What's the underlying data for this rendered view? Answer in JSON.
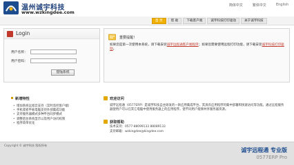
{
  "header": {
    "brand_title": "温州诚宇科技",
    "brand_url": "www.wzkingdee.com",
    "lang_links": [
      "简体中文",
      "繁体中文",
      "English"
    ]
  },
  "nav": {
    "tabs": [
      "首 页",
      "帮 助",
      "下载客户端",
      "诚宇科技打印驱动",
      "关于诚宇科技"
    ],
    "active_index": 0
  },
  "login": {
    "title": "Login",
    "username_label": "用户名称：",
    "username_value": "",
    "password_label": "用户密码：",
    "password_value": "",
    "submit_label": "登陆系统"
  },
  "notice": {
    "title": "重要提醒！",
    "line1_prefix": "如果您是第一次使用本系统，请下载安装",
    "line1_link": "诚宇远程通客户端程序",
    "line1_mid": "；如果您需要使用远程打印功能，请下载安装",
    "line1_link2": "诚宇科技打印驱动",
    "line1_suffix": "。"
  },
  "features": {
    "title": "新增特性",
    "items": [
      "增加系统远程云支持（实时监控客户端）",
      "手机或者平板电脑支持外部集成功能",
      "支持服务器模式多种平台同步模式",
      "调整后台系统显示以及用户访问权限",
      "程序简单优化"
    ]
  },
  "welcome": {
    "title": "欢迎访问",
    "body": "诚宇远程通（0577ERP）是诚宇科技自主研发的一款应用集成平台，其具有应用程序的集中部署和快速访问等功能。通过远程服务器使用户可以在其它电脑中使用服务器上的应用程序，使不同用户能够共享服务器资源。"
  },
  "help": {
    "title": "获取帮助",
    "rows": [
      "技术支持：0577-88099133  88089133",
      "支持邮箱：wzkingdee@kingdee.com"
    ]
  },
  "footer": {
    "copyright": "Copyright © 诚宇科技 版权所有",
    "product_name": "诚宇远程通  专业版",
    "product_sub": "0577ERP Pro"
  }
}
